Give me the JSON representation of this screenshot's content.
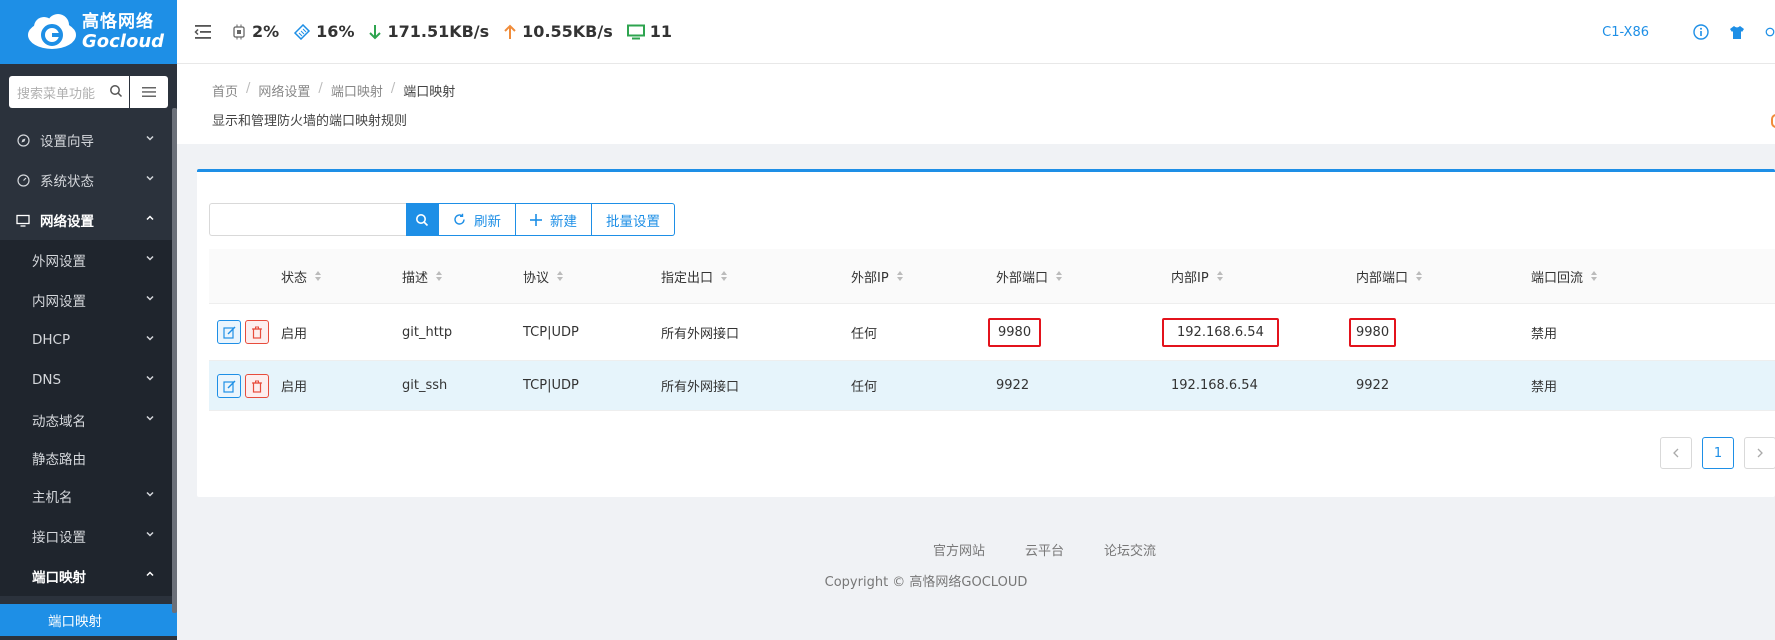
{
  "brand": {
    "name_cn": "高恪网络",
    "name_en": "Gocloud",
    "color": "#1e8fe6"
  },
  "sidebar": {
    "search_placeholder": "搜索菜单功能",
    "menu": [
      {
        "label": "设置向导"
      },
      {
        "label": "系统状态"
      },
      {
        "label": "网络设置"
      }
    ],
    "submenu": [
      {
        "label": "外网设置"
      },
      {
        "label": "内网设置"
      },
      {
        "label": "DHCP"
      },
      {
        "label": "DNS"
      },
      {
        "label": "动态域名"
      },
      {
        "label": "静态路由"
      },
      {
        "label": "主机名"
      },
      {
        "label": "接口设置"
      },
      {
        "label": "端口映射"
      }
    ],
    "active_leaf": "端口映射"
  },
  "topbar": {
    "cpu": "2%",
    "memory": "16%",
    "download": "171.51KB/s",
    "upload": "10.55KB/s",
    "devices": "11",
    "model": "C1-X86"
  },
  "page": {
    "breadcrumb": [
      "首页",
      "网络设置",
      "端口映射",
      "端口映射"
    ],
    "description": "显示和管理防火墙的端口映射规则"
  },
  "toolbar": {
    "refresh": "刷新",
    "new": "新建",
    "batch": "批量设置"
  },
  "table": {
    "columns": [
      "状态",
      "描述",
      "协议",
      "指定出口",
      "外部IP",
      "外部端口",
      "内部IP",
      "内部端口",
      "端口回流"
    ],
    "rows": [
      {
        "status": "启用",
        "desc": "git_http",
        "protocol": "TCP|UDP",
        "outlet": "所有外网接口",
        "ext_ip": "任何",
        "ext_port": "9980",
        "int_ip": "192.168.6.54",
        "int_port": "9980",
        "loopback": "禁用"
      },
      {
        "status": "启用",
        "desc": "git_ssh",
        "protocol": "TCP|UDP",
        "outlet": "所有外网接口",
        "ext_ip": "任何",
        "ext_port": "9922",
        "int_ip": "192.168.6.54",
        "int_port": "9922",
        "loopback": "禁用"
      }
    ]
  },
  "pagination": {
    "current": "1"
  },
  "footer": {
    "links": [
      "官方网站",
      "云平台",
      "论坛交流"
    ],
    "copyright": "Copyright © 高恪网络GOCLOUD"
  }
}
